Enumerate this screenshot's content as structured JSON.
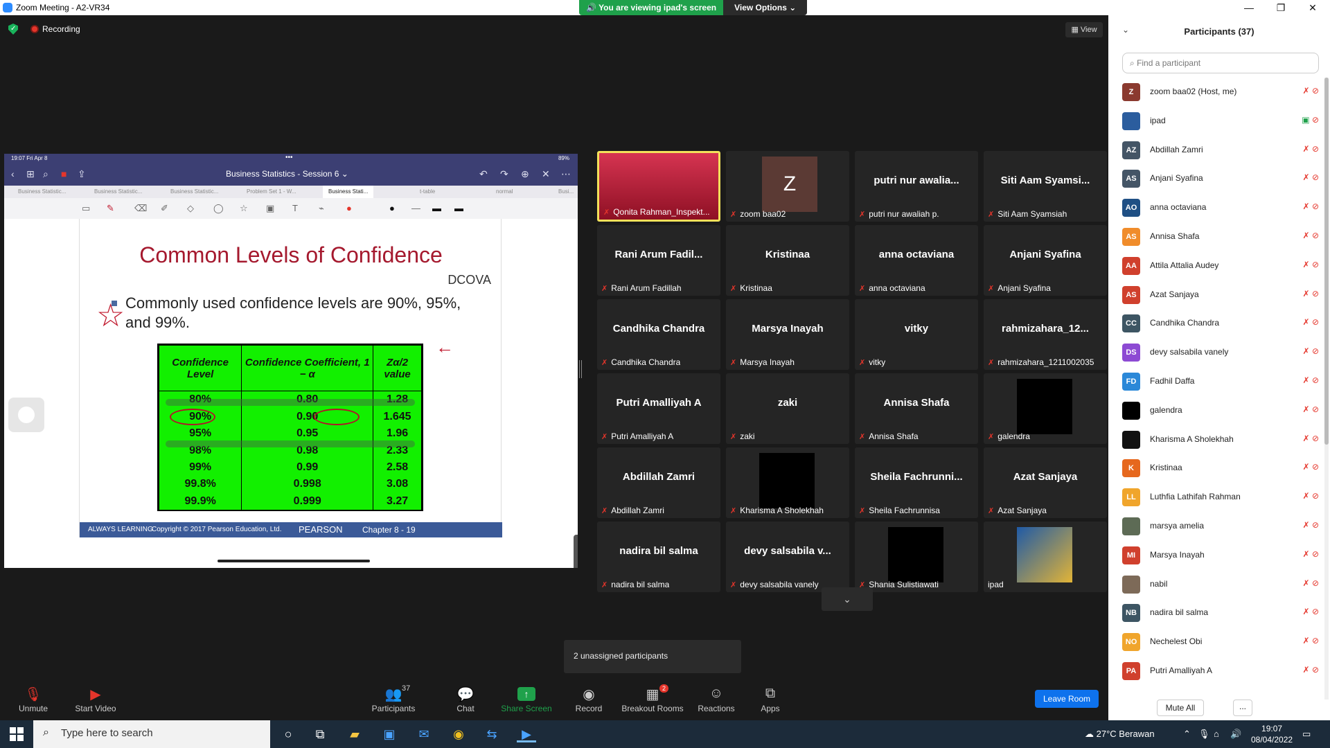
{
  "window": {
    "title": "Zoom Meeting - A2-VR34",
    "min": "—",
    "max": "❐",
    "close": "✕"
  },
  "banner": {
    "viewing": "You are viewing ipad's screen",
    "view_options": "View Options ⌄"
  },
  "top": {
    "recording": "Recording",
    "view": "View"
  },
  "ipad": {
    "time": "19:07  Fri Apr 8",
    "battery": "89%",
    "doc_title": "Business Statistics - Session 6 ⌄",
    "tabs": [
      "Business Statistic...",
      "Business Statistic...",
      "Business Statistic...",
      "Problem Set 1 - W...",
      "Business Stati...",
      "t-table",
      "normal",
      "Busi..."
    ],
    "slide": {
      "title": "Common Levels of Confidence",
      "dcova": "DCOVA",
      "bullet": "Commonly used confidence levels are 90%, 95%, and 99%.",
      "headers": [
        "Confidence Level",
        "Confidence Coefficient, 1 − α",
        "Zα/2 value"
      ],
      "rows": [
        [
          "80%",
          "0.80",
          "1.28"
        ],
        [
          "90%",
          "0.90",
          "1.645"
        ],
        [
          "95%",
          "0.95",
          "1.96"
        ],
        [
          "98%",
          "0.98",
          "2.33"
        ],
        [
          "99%",
          "0.99",
          "2.58"
        ],
        [
          "99.8%",
          "0.998",
          "3.08"
        ],
        [
          "99.9%",
          "0.999",
          "3.27"
        ]
      ],
      "footer_left": "ALWAYS LEARNING",
      "footer_copy": "Copyright © 2017 Pearson Education, Ltd.",
      "footer_brand": "PEARSON",
      "footer_chapter": "Chapter 8 - 19"
    }
  },
  "tiles": [
    {
      "big": "",
      "name": "Qonita Rahman_Inspekt...",
      "type": "video",
      "active": true
    },
    {
      "big": "",
      "name": "zoom baa02",
      "type": "avatar",
      "avatar": "Z"
    },
    {
      "big": "putri  nur  awalia...",
      "name": "putri nur awaliah p.",
      "type": "text"
    },
    {
      "big": "Siti  Aam  Syamsi...",
      "name": "Siti Aam Syamsiah",
      "type": "text"
    },
    {
      "big": "Rani  Arum  Fadil...",
      "name": "Rani Arum Fadillah",
      "type": "text"
    },
    {
      "big": "Kristinaa",
      "name": "Kristinaa",
      "type": "text"
    },
    {
      "big": "anna  octaviana",
      "name": "anna octaviana",
      "type": "text"
    },
    {
      "big": "Anjani  Syafina",
      "name": "Anjani Syafina",
      "type": "text"
    },
    {
      "big": "Candhika  Chandra",
      "name": "Candhika Chandra",
      "type": "text"
    },
    {
      "big": "Marsya  Inayah",
      "name": "Marsya Inayah",
      "type": "text"
    },
    {
      "big": "vitky",
      "name": "vitky",
      "type": "text"
    },
    {
      "big": "rahmizahara_12...",
      "name": "rahmizahara_1211002035",
      "type": "text"
    },
    {
      "big": "Putri  Amalliyah  A",
      "name": "Putri Amalliyah A",
      "type": "text"
    },
    {
      "big": "zaki",
      "name": "zaki",
      "type": "text"
    },
    {
      "big": "Annisa  Shafa",
      "name": "Annisa Shafa",
      "type": "text"
    },
    {
      "big": "",
      "name": "galendra",
      "type": "black"
    },
    {
      "big": "Abdillah  Zamri",
      "name": "Abdillah Zamri",
      "type": "text"
    },
    {
      "big": "",
      "name": "Kharisma A Sholekhah",
      "type": "black"
    },
    {
      "big": "Sheila  Fachrunni...",
      "name": "Sheila Fachrunnisa",
      "type": "text"
    },
    {
      "big": "Azat  Sanjaya",
      "name": "Azat Sanjaya",
      "type": "text"
    },
    {
      "big": "nadira  bil  salma",
      "name": "nadira bil salma",
      "type": "text"
    },
    {
      "big": "devy  salsabila  v...",
      "name": "devy salsabila vanely",
      "type": "text"
    },
    {
      "big": "",
      "name": "Shania Sulistiawati",
      "type": "black"
    },
    {
      "big": "",
      "name": "ipad",
      "type": "photo",
      "nomic": true
    }
  ],
  "unassigned": "2 unassigned participants",
  "toolbar": {
    "unmute": "Unmute",
    "start_video": "Start Video",
    "participants": "Participants",
    "participants_count": "37",
    "chat": "Chat",
    "share_screen": "Share Screen",
    "record": "Record",
    "breakout": "Breakout Rooms",
    "breakout_badge": "2",
    "reactions": "Reactions",
    "apps": "Apps",
    "leave": "Leave Room"
  },
  "panel": {
    "title": "Participants (37)",
    "find_placeholder": "Find a participant",
    "mute_all": "Mute All",
    "more": "...",
    "participants": [
      {
        "initials": "Z",
        "name": "zoom baa02 (Host, me)",
        "color": "#8b3a2f"
      },
      {
        "initials": "",
        "name": "ipad",
        "color": "#2b5d9e",
        "sharing": true
      },
      {
        "initials": "AZ",
        "name": "Abdillah Zamri",
        "color": "#445566"
      },
      {
        "initials": "AS",
        "name": "Anjani Syafina",
        "color": "#445566"
      },
      {
        "initials": "AO",
        "name": "anna octaviana",
        "color": "#1f4f84"
      },
      {
        "initials": "AS",
        "name": "Annisa Shafa",
        "color": "#f08c2b"
      },
      {
        "initials": "AA",
        "name": "Attila Attalia Audey",
        "color": "#d0402d"
      },
      {
        "initials": "AS",
        "name": "Azat Sanjaya",
        "color": "#d0402d"
      },
      {
        "initials": "CC",
        "name": "Candhika Chandra",
        "color": "#3d5563"
      },
      {
        "initials": "DS",
        "name": "devy salsabila vanely",
        "color": "#8d4ad3"
      },
      {
        "initials": "FD",
        "name": "Fadhil Daffa",
        "color": "#2b88d8"
      },
      {
        "initials": "",
        "name": "galendra",
        "color": "#000000"
      },
      {
        "initials": "",
        "name": "Kharisma A Sholekhah",
        "color": "#111111"
      },
      {
        "initials": "K",
        "name": "Kristinaa",
        "color": "#e6681e"
      },
      {
        "initials": "LL",
        "name": "Luthfia Lathifah Rahman",
        "color": "#f0a52c"
      },
      {
        "initials": "",
        "name": "marsya amelia",
        "color": "#5d6b55"
      },
      {
        "initials": "MI",
        "name": "Marsya Inayah",
        "color": "#d0402d"
      },
      {
        "initials": "",
        "name": "nabil",
        "color": "#7d6a58"
      },
      {
        "initials": "NB",
        "name": "nadira bil salma",
        "color": "#3d5563"
      },
      {
        "initials": "NO",
        "name": "Nechelest Obi",
        "color": "#f0a52c"
      },
      {
        "initials": "PA",
        "name": "Putri Amalliyah A",
        "color": "#d0402d"
      }
    ]
  },
  "taskbar": {
    "search": "Type here to search",
    "weather": "27°C  Berawan",
    "time": "19:07",
    "date": "08/04/2022"
  }
}
